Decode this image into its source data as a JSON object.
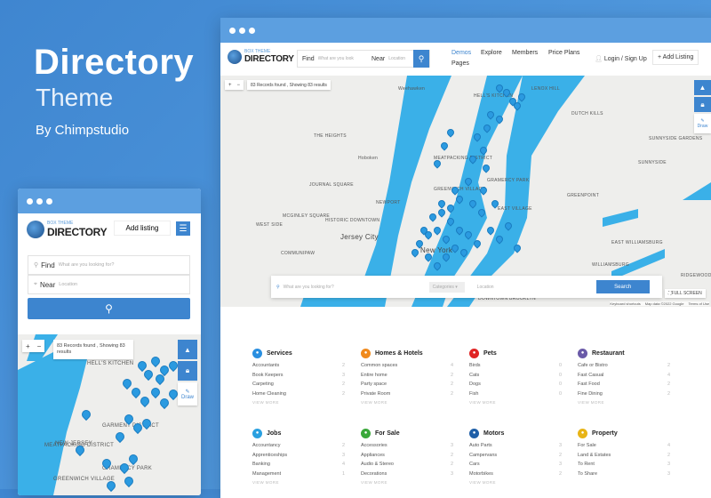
{
  "hero": {
    "title": "Directory",
    "subtitle": "Theme",
    "byline": "By Chimpstudio"
  },
  "logo": {
    "top": "BOX THEME",
    "name": "DIRECTORY"
  },
  "colors": {
    "background": "#4a8fd6",
    "accent": "#3d85cf",
    "water": "#3ab0e8",
    "pin": "#2b9ae0"
  },
  "desktop": {
    "search": {
      "find_label": "Find",
      "find_placeholder": "What are you looking for?",
      "near_label": "Near",
      "near_placeholder": "Location",
      "icon": "search-icon"
    },
    "nav": [
      "Demos",
      "Explore",
      "Members",
      "Price Plans",
      "Pages"
    ],
    "login": "Login / Sign Up",
    "add_listing": "+ Add Listing",
    "map": {
      "records": "83 Records found , Showing 83 results",
      "zoom_in": "+",
      "zoom_out": "−",
      "draw": "Draw",
      "fullscreen": "FULL SCREEN",
      "search_placeholder": "What are you looking for?",
      "categories": "Categories ▾",
      "location": "Location",
      "search_btn": "Search",
      "attribution": [
        "Keyboard shortcuts",
        "Map data ©2022 Google",
        "Terms of Use"
      ],
      "labels": [
        "Weehawken",
        "HELL'S KITCHEN",
        "LENOX HILL",
        "DUTCH KILLS",
        "THE HEIGHTS",
        "Hoboken",
        "SUNNYSIDE GARDENS",
        "SUNNYSIDE",
        "JOURNAL SQUARE",
        "MEATPACKING DISTRICT",
        "GRAMERCY PARK",
        "GREENPOINT",
        "NEWPORT",
        "MCGINLEY SQUARE",
        "HISTORIC DOWNTOWN",
        "WEST SIDE",
        "Jersey City",
        "EAST VILLAGE",
        "COMMUNIPAW",
        "New York",
        "EAST WILLIAMSBURG",
        "WILLIAMSBURG",
        "RIDGEWOOD",
        "DOWNTOWN BROOKLYN",
        "GREENWICH VILLAGE"
      ]
    },
    "categories": [
      {
        "name": "Services",
        "color": "#2a8fe0",
        "icon": "chat-icon",
        "items": [
          [
            "Accountants",
            "2"
          ],
          [
            "Book Keepers",
            "3"
          ],
          [
            "Carpeting",
            "2"
          ],
          [
            "Home Cleaning",
            "2"
          ]
        ],
        "more": "VIEW MORE"
      },
      {
        "name": "Homes & Hotels",
        "color": "#f08a1c",
        "icon": "hotel-icon",
        "items": [
          [
            "Common spaces",
            "4"
          ],
          [
            "Entire home",
            "2"
          ],
          [
            "Party space",
            "2"
          ],
          [
            "Private Room",
            "2"
          ]
        ],
        "more": "VIEW MORE"
      },
      {
        "name": "Pets",
        "color": "#e02424",
        "icon": "paw-icon",
        "items": [
          [
            "Birds",
            "0"
          ],
          [
            "Cats",
            "0"
          ],
          [
            "Dogs",
            "0"
          ],
          [
            "Fish",
            "0"
          ]
        ],
        "more": "VIEW MORE"
      },
      {
        "name": "Restaurant",
        "color": "#6a5aa8",
        "icon": "cutlery-icon",
        "items": [
          [
            "Cafe or Bistro",
            "2"
          ],
          [
            "Fast Casual",
            "4"
          ],
          [
            "Fast Food",
            "2"
          ],
          [
            "Fine Dining",
            "2"
          ]
        ],
        "more": "VIEW MORE"
      },
      {
        "name": "Jobs",
        "color": "#2aa0e0",
        "icon": "briefcase-icon",
        "items": [
          [
            "Accountancy",
            "2"
          ],
          [
            "Apprenticeships",
            "3"
          ],
          [
            "Banking",
            "4"
          ],
          [
            "Management",
            "1"
          ]
        ],
        "more": "VIEW MORE"
      },
      {
        "name": "For Sale",
        "color": "#3aa83a",
        "icon": "cart-icon",
        "items": [
          [
            "Accessories",
            "3"
          ],
          [
            "Appliances",
            "2"
          ],
          [
            "Audio & Stereo",
            "2"
          ],
          [
            "Decorations",
            "3"
          ]
        ],
        "more": "VIEW MORE"
      },
      {
        "name": "Motors",
        "color": "#1f5fa8",
        "icon": "car-icon",
        "items": [
          [
            "Auto Parts",
            "3"
          ],
          [
            "Campervans",
            "2"
          ],
          [
            "Cars",
            "3"
          ],
          [
            "Motorbikes",
            "2"
          ]
        ],
        "more": "VIEW MORE"
      },
      {
        "name": "Property",
        "color": "#e8b416",
        "icon": "home-icon",
        "items": [
          [
            "For Sale",
            "4"
          ],
          [
            "Land & Estates",
            "2"
          ],
          [
            "To Rent",
            "3"
          ],
          [
            "To Share",
            "3"
          ]
        ],
        "more": ""
      }
    ]
  },
  "mobile": {
    "add_listing": "Add listing",
    "find_label": "Find",
    "find_placeholder": "What are you looking for?",
    "near_label": "Near",
    "near_placeholder": "Location",
    "records": "83 Records found , Showing 83 results",
    "draw": "Draw",
    "labels": [
      "HELL'S KITCHEN",
      "GARMENT DISTRICT",
      "NEW JERSEY",
      "MEATPACKING DISTRICT",
      "GRAMERCY PARK",
      "GREENWICH VILLAGE"
    ]
  }
}
